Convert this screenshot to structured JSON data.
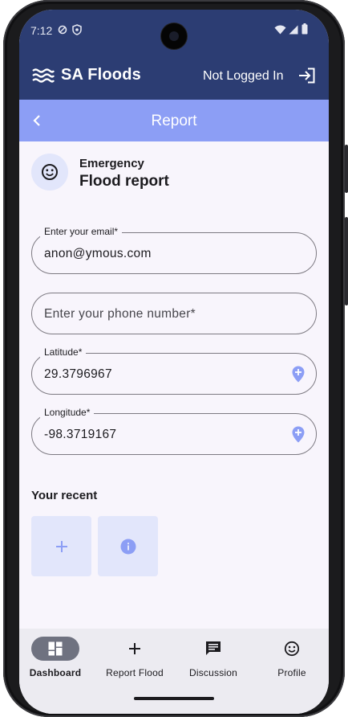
{
  "status_bar": {
    "time": "7:12",
    "icons": [
      "data-saver-icon",
      "shield-icon",
      "wifi-icon",
      "signal-icon",
      "battery-icon"
    ]
  },
  "app_bar": {
    "title": "SA Floods",
    "logo_icon": "waves-icon",
    "login_status": "Not Logged In",
    "login_icon": "login-icon"
  },
  "title_bar": {
    "title": "Report",
    "back_icon": "chevron-left-icon"
  },
  "header": {
    "overline": "Emergency",
    "title": "Flood report",
    "avatar_icon": "smiley-face-icon"
  },
  "form": {
    "email": {
      "label": "Enter your email*",
      "value": "anon@ymous.com"
    },
    "phone": {
      "placeholder": "Enter your phone number*"
    },
    "latitude": {
      "label": "Latitude*",
      "value": "29.3796967",
      "icon": "add-location-icon"
    },
    "longitude": {
      "label": "Longitude*",
      "value": "-98.3719167",
      "icon": "add-location-icon"
    }
  },
  "recent": {
    "title": "Your recent",
    "tiles": [
      {
        "icon": "plus-icon"
      },
      {
        "icon": "info-icon"
      }
    ]
  },
  "nav": {
    "items": [
      {
        "label": "Dashboard",
        "icon": "dashboard-icon",
        "active": true
      },
      {
        "label": "Report Flood",
        "icon": "plus-icon",
        "active": false
      },
      {
        "label": "Discussion",
        "icon": "chat-icon",
        "active": false
      },
      {
        "label": "Profile",
        "icon": "smiley-face-icon",
        "active": false
      }
    ]
  },
  "colors": {
    "app_bar": "#2c3d73",
    "title_bar": "#8c9ef5",
    "accent": "#8c9ef5",
    "surface": "#f8f5fc",
    "tile": "#e2e6fb",
    "nav_active": "#6f7280"
  }
}
